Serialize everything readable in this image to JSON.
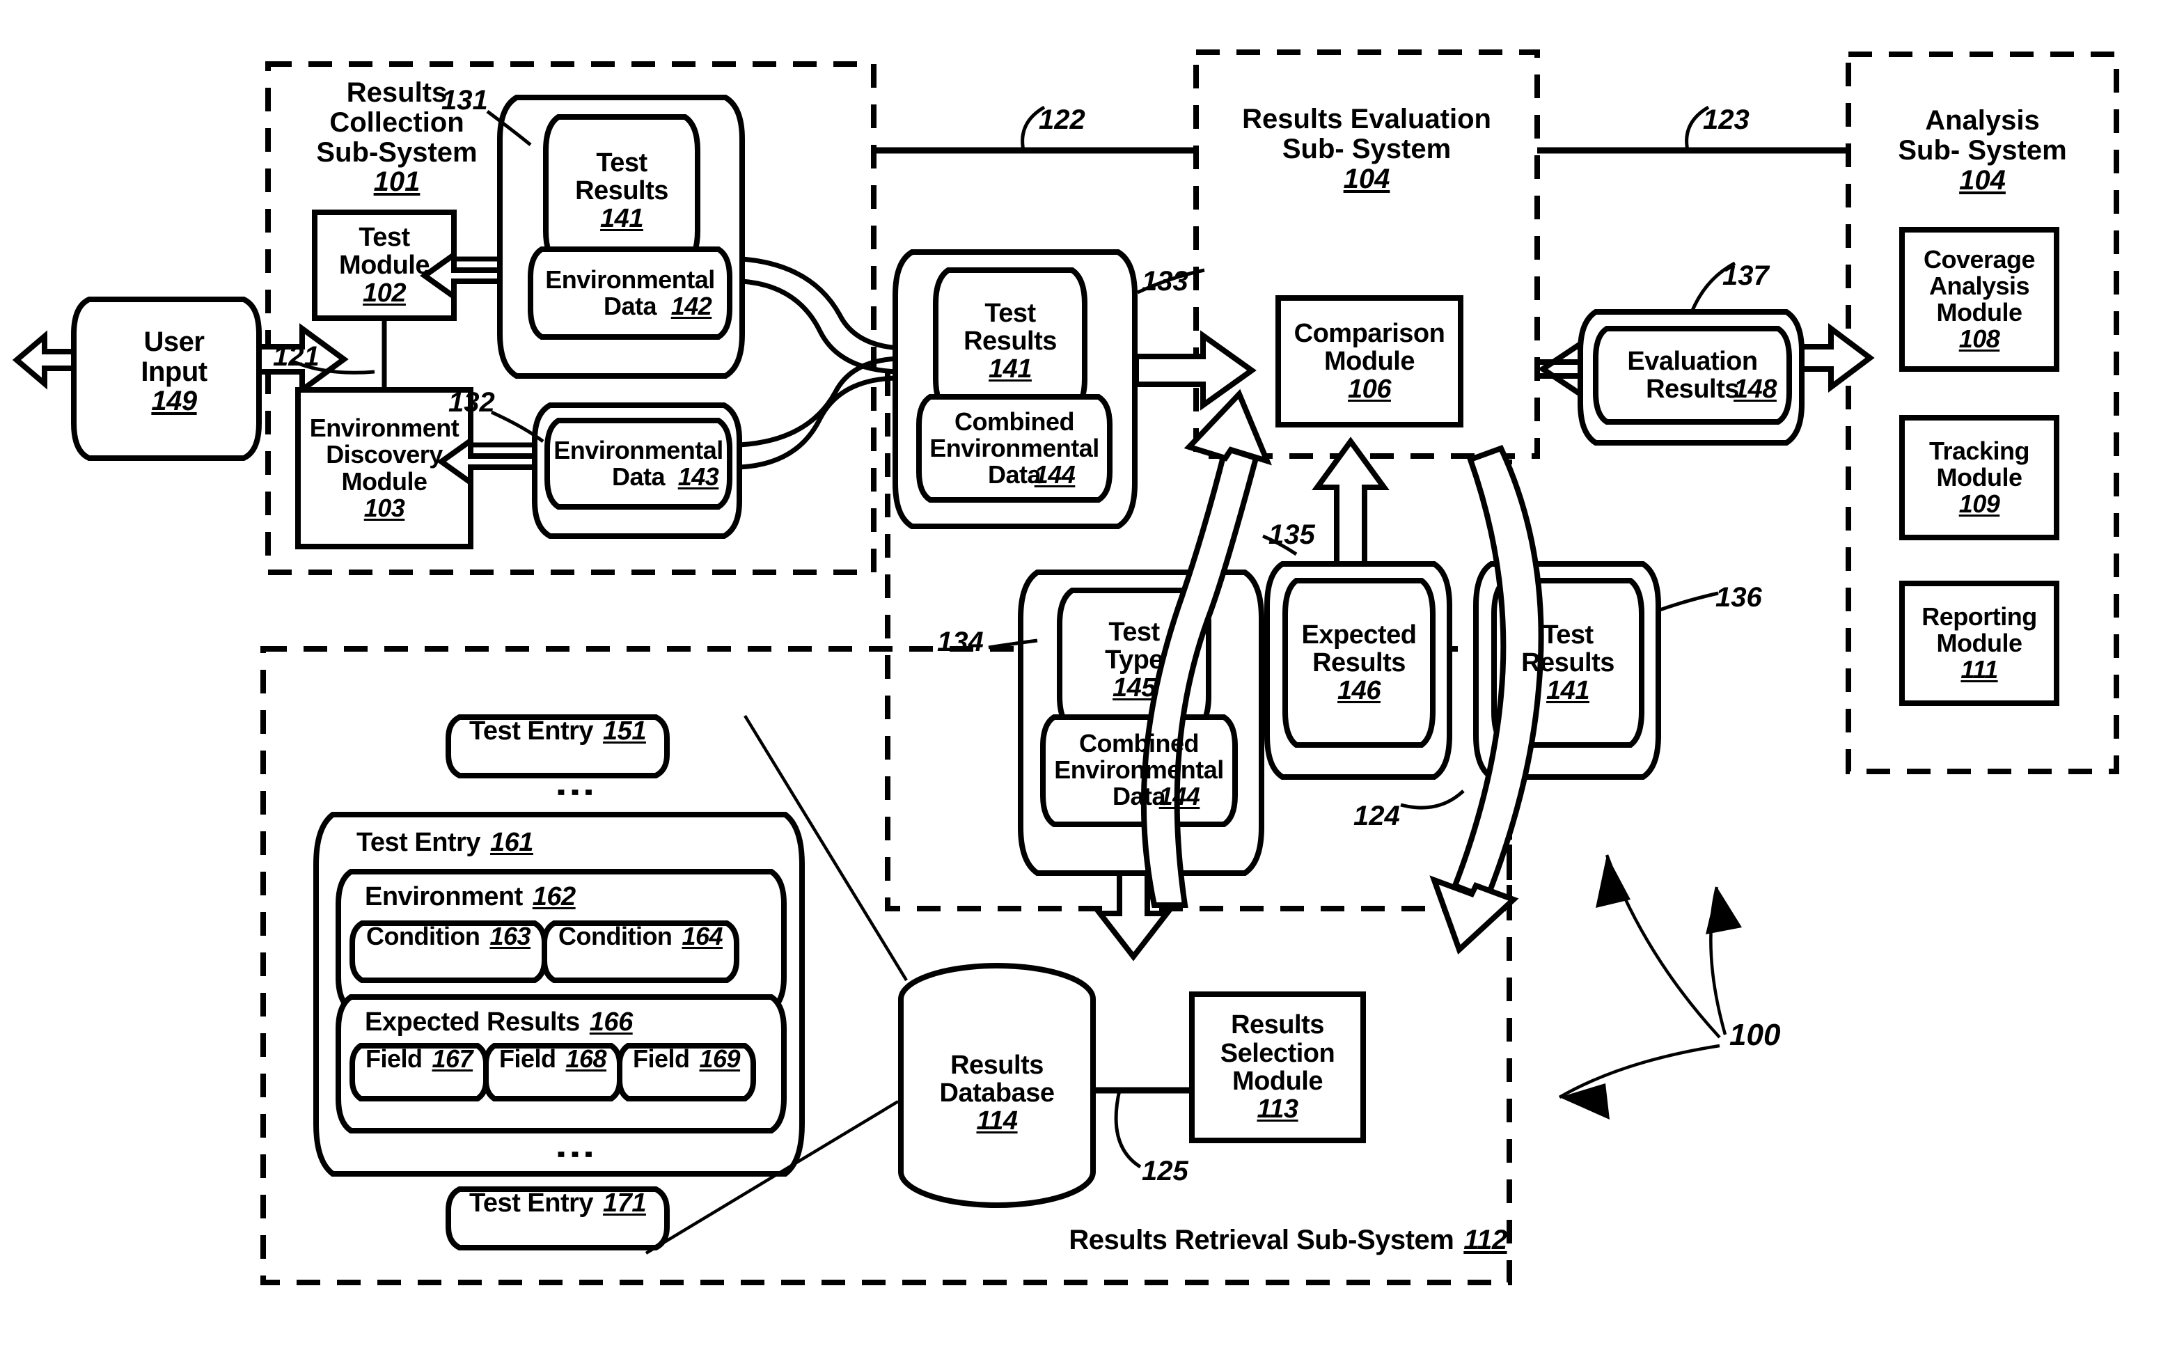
{
  "figure": {
    "system_ref": "100"
  },
  "subsystems": [
    {
      "id": "results-collection",
      "line1": "Results",
      "line2": "Collection",
      "line3": "Sub-System",
      "ref": "101"
    },
    {
      "id": "results-evaluation",
      "line1": "Results Evaluation",
      "line2": "Sub- System",
      "ref": "104"
    },
    {
      "id": "analysis",
      "line1": "Analysis",
      "line2": "Sub- System",
      "ref": "104"
    },
    {
      "id": "results-retrieval",
      "line1": "Results Retrieval Sub-System",
      "ref": "112"
    }
  ],
  "modules": [
    {
      "id": "test-module",
      "label": "Test\nModule",
      "ref": "102"
    },
    {
      "id": "environment-discovery-module",
      "label": "Environment\nDiscovery\nModule",
      "ref": "103"
    },
    {
      "id": "comparison-module",
      "label": "Comparison\nModule",
      "ref": "106"
    },
    {
      "id": "coverage-analysis-module",
      "label": "Coverage\nAnalysis\nModule",
      "ref": "108"
    },
    {
      "id": "tracking-module",
      "label": "Tracking\nModule",
      "ref": "109"
    },
    {
      "id": "reporting-module",
      "label": "Reporting\nModule",
      "ref": "111"
    },
    {
      "id": "results-selection-module",
      "label": "Results\nSelection\nModule",
      "ref": "113"
    }
  ],
  "database": {
    "label": "Results\nDatabase",
    "ref": "114"
  },
  "user_input": {
    "label": "User\nInput",
    "ref": "149"
  },
  "documents": [
    {
      "id": "doc-131",
      "ref": "131",
      "items": [
        {
          "label": "Test\nResults",
          "ref": "141"
        },
        {
          "label": "Environmental\nData",
          "ref": "142",
          "inline": true
        }
      ]
    },
    {
      "id": "doc-132",
      "ref": "132",
      "items": [
        {
          "label": "Environmental\nData",
          "ref": "143",
          "inline": true
        }
      ]
    },
    {
      "id": "doc-133",
      "ref": "133",
      "items": [
        {
          "label": "Test\nResults",
          "ref": "141"
        },
        {
          "label": "Combined\nEnvironmental\nData",
          "ref": "144",
          "inline": true
        }
      ]
    },
    {
      "id": "doc-134",
      "ref": "134",
      "items": [
        {
          "label": "Test\nType",
          "ref": "145"
        },
        {
          "label": "Combined\nEnvironmental\nData",
          "ref": "144",
          "inline": true
        }
      ]
    },
    {
      "id": "doc-135",
      "ref": "135",
      "items": [
        {
          "label": "Expected\nResults",
          "ref": "146"
        }
      ]
    },
    {
      "id": "doc-136",
      "ref": "136",
      "items": [
        {
          "label": "Test\nResults",
          "ref": "141"
        }
      ]
    },
    {
      "id": "doc-137",
      "ref": "137",
      "items": [
        {
          "label": "Evaluation\nResults",
          "ref": "148",
          "inline": true
        }
      ]
    }
  ],
  "test_entries": {
    "top": {
      "label": "Test Entry",
      "ref": "151"
    },
    "bottom": {
      "label": "Test Entry",
      "ref": "171"
    },
    "main": {
      "label": "Test Entry",
      "ref": "161",
      "environment": {
        "label": "Environment",
        "ref": "162",
        "conditions": [
          {
            "label": "Condition",
            "ref": "163"
          },
          {
            "label": "Condition",
            "ref": "164"
          }
        ]
      },
      "expected_results": {
        "label": "Expected Results",
        "ref": "166",
        "fields": [
          {
            "label": "Field",
            "ref": "167"
          },
          {
            "label": "Field",
            "ref": "168"
          },
          {
            "label": "Field",
            "ref": "169"
          }
        ]
      }
    },
    "ellipsis": "⋮"
  },
  "connector_refs": [
    {
      "id": "ref-121",
      "text": "121"
    },
    {
      "id": "ref-122",
      "text": "122"
    },
    {
      "id": "ref-123",
      "text": "123"
    },
    {
      "id": "ref-124",
      "text": "124"
    },
    {
      "id": "ref-125",
      "text": "125"
    },
    {
      "id": "ref-131",
      "text": "131"
    },
    {
      "id": "ref-132",
      "text": "132"
    },
    {
      "id": "ref-133",
      "text": "133"
    },
    {
      "id": "ref-134",
      "text": "134"
    },
    {
      "id": "ref-135",
      "text": "135"
    },
    {
      "id": "ref-136",
      "text": "136"
    },
    {
      "id": "ref-137",
      "text": "137"
    },
    {
      "id": "ref-100",
      "text": "100"
    }
  ],
  "colors": {
    "ink": "#000000",
    "paper": "#ffffff"
  }
}
